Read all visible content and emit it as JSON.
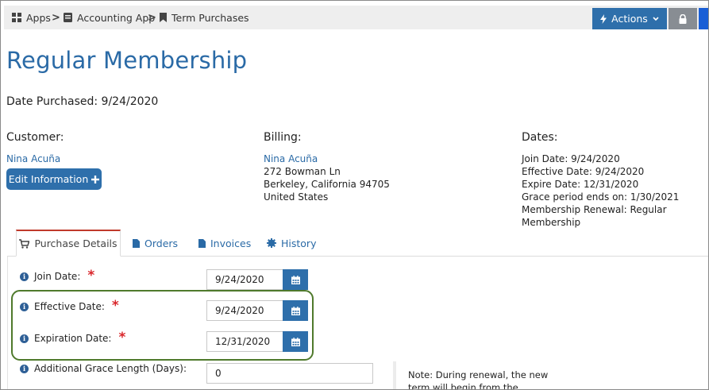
{
  "breadcrumb": {
    "apps": "Apps",
    "accounting": "Accounting App",
    "term_purchases": "Term Purchases",
    "separator": ">"
  },
  "toolbar": {
    "actions_label": "Actions"
  },
  "page": {
    "title": "Regular Membership",
    "date_purchased": "Date Purchased: 9/24/2020"
  },
  "customer": {
    "heading": "Customer:",
    "name": "Nina Acuña",
    "edit_label": "Edit Information"
  },
  "billing": {
    "heading": "Billing:",
    "name": "Nina Acuña",
    "street": "272 Bowman Ln",
    "city": "Berkeley, California 94705",
    "country": "United States"
  },
  "dates": {
    "heading": "Dates:",
    "join": "Join Date: 9/24/2020",
    "effective": "Effective Date: 9/24/2020",
    "expire": "Expire Date: 12/31/2020",
    "grace": "Grace period ends on: 1/30/2021",
    "renewal": "Membership Renewal: Regular Membership"
  },
  "tabs": [
    {
      "label": "Purchase Details"
    },
    {
      "label": "Orders"
    },
    {
      "label": "Invoices"
    },
    {
      "label": "History"
    }
  ],
  "form": {
    "join": {
      "label": "Join Date:",
      "value": "9/24/2020"
    },
    "effective": {
      "label": "Effective Date:",
      "value": "9/24/2020"
    },
    "expiration": {
      "label": "Expiration Date:",
      "value": "12/31/2020"
    },
    "grace": {
      "label": "Additional Grace Length (Days):",
      "value": "0"
    },
    "required_mark": "*",
    "info_glyph": "i"
  },
  "note": {
    "text": "Note: During renewal, the new term will begin from the"
  },
  "colors": {
    "accent": "#2e6fab",
    "link": "#2a6aa6",
    "required": "#d9262b",
    "highlight": "#4f7a2c",
    "active_tab_top": "#c0392b"
  }
}
